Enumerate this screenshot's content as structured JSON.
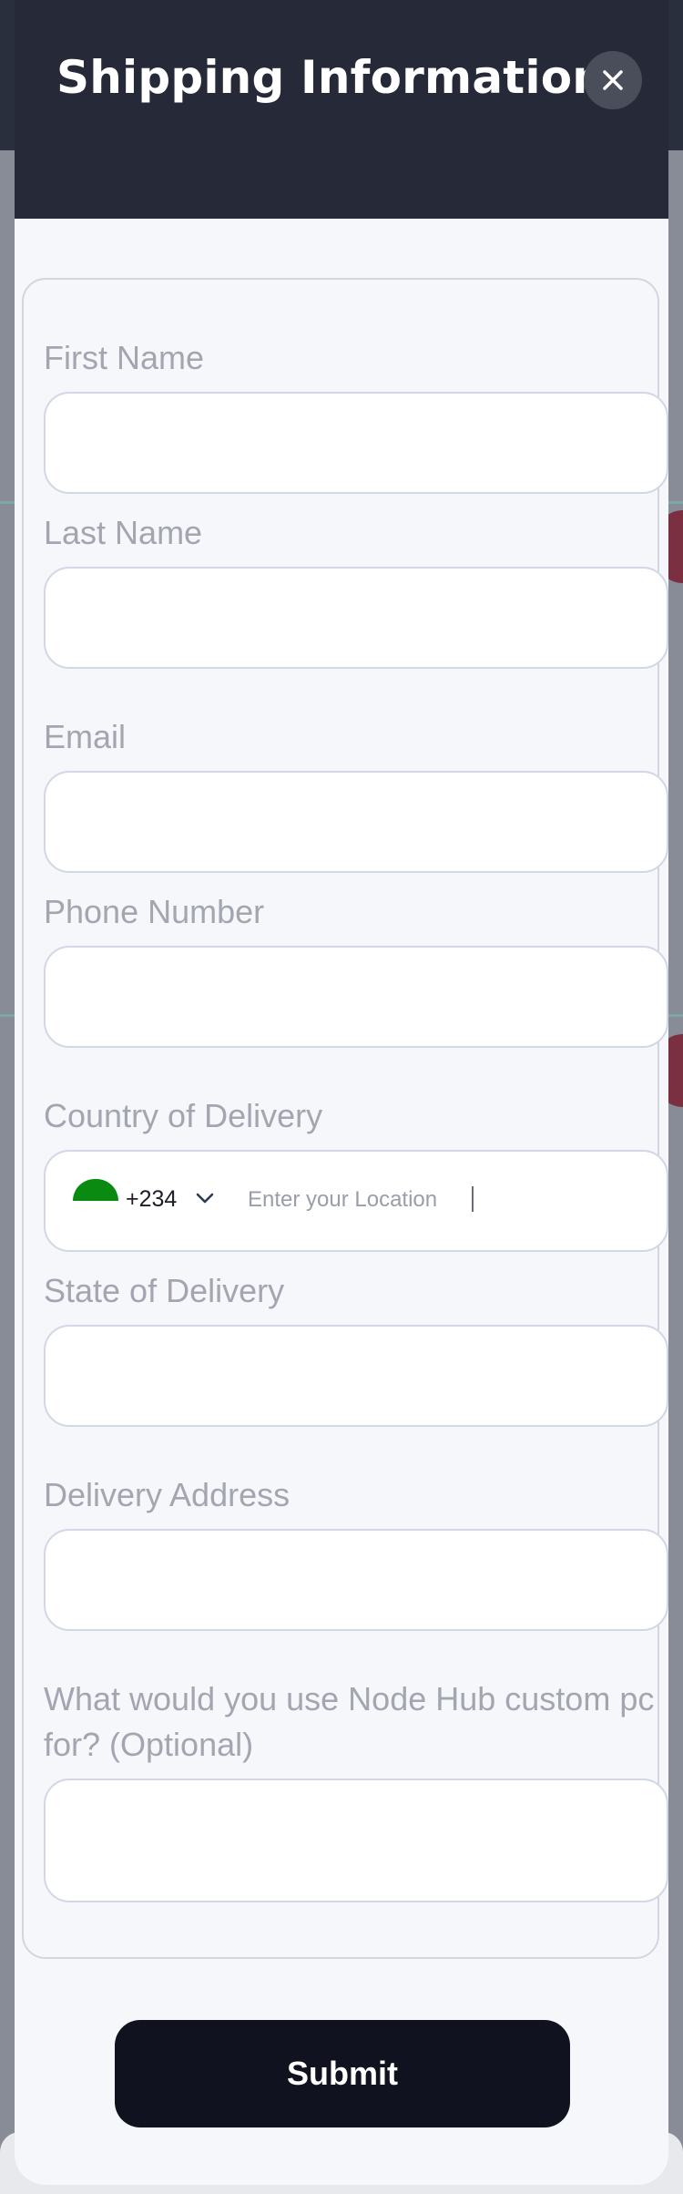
{
  "modal": {
    "title": "Shipping Information",
    "close_icon": "close-icon"
  },
  "form": {
    "fields": [
      {
        "label": "First Name",
        "value": "",
        "placeholder": ""
      },
      {
        "label": "Last Name",
        "value": "",
        "placeholder": ""
      },
      {
        "label": "Email",
        "value": "",
        "placeholder": ""
      },
      {
        "label": "Phone Number",
        "value": "",
        "placeholder": ""
      },
      {
        "label": "Country of Delivery",
        "dial_code": "+234",
        "placeholder": "Enter your Location",
        "flag_icon": "nigeria-flag-icon",
        "chevron_icon": "chevron-down-icon"
      },
      {
        "label": "State of Delivery",
        "value": "",
        "placeholder": ""
      },
      {
        "label": "Delivery Address",
        "value": "",
        "placeholder": ""
      },
      {
        "label": "What would you use Node Hub custom pc for? (Optional)",
        "value": "",
        "placeholder": ""
      }
    ],
    "submit_label": "Submit"
  },
  "colors": {
    "header_bg": "#262a38",
    "submit_bg": "#10131f",
    "label": "#a3a6b0",
    "flag_green": "#0b8a11"
  }
}
